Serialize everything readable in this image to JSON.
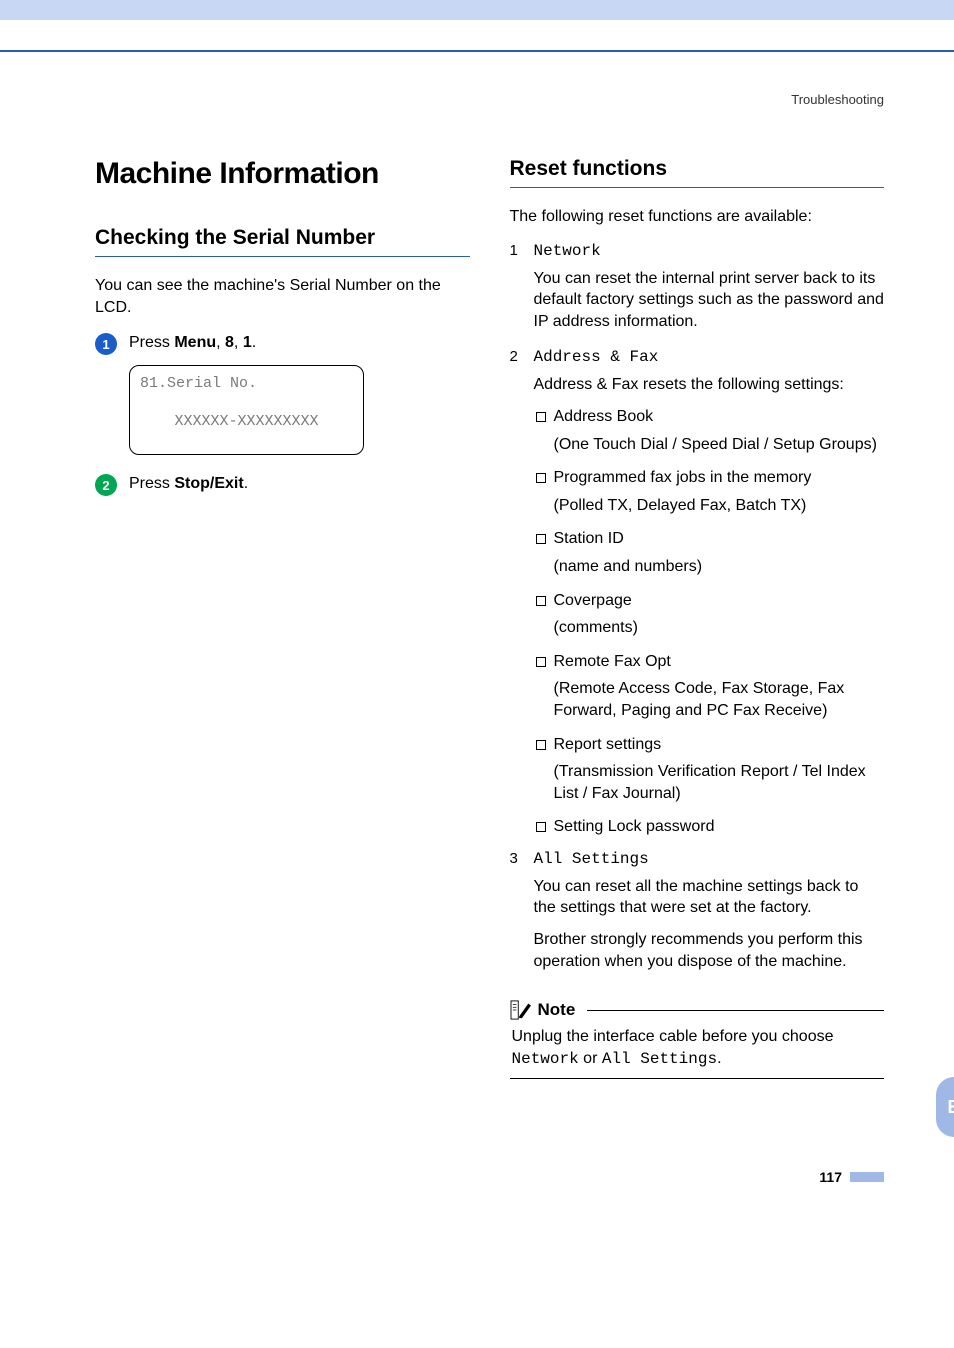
{
  "running_head": "Troubleshooting",
  "side_tab": "B",
  "page_number": "117",
  "left": {
    "h1": "Machine Information",
    "h2": "Checking the Serial Number",
    "intro": "You can see the machine's Serial Number on the LCD.",
    "step1_prefix": "Press ",
    "step1_b1": "Menu",
    "step1_mid1": ", ",
    "step1_b2": "8",
    "step1_mid2": ", ",
    "step1_b3": "1",
    "step1_suffix": ".",
    "lcd_line1": "81.Serial No.",
    "lcd_line2": "XXXXXX-XXXXXXXXX",
    "step2_prefix": "Press ",
    "step2_b1": "Stop/Exit",
    "step2_suffix": "."
  },
  "right": {
    "h2": "Reset functions",
    "intro": "The following reset functions are available:",
    "items": [
      {
        "n": "1",
        "label": "Network",
        "body": "You can reset the internal print server back to its default factory settings such as the password and IP address information."
      },
      {
        "n": "2",
        "label": "Address & Fax",
        "body": "Address & Fax resets the following settings:",
        "bullets": [
          {
            "title": "Address Book",
            "detail": "(One Touch Dial / Speed Dial / Setup Groups)"
          },
          {
            "title": "Programmed fax jobs in the memory",
            "detail": "(Polled TX, Delayed Fax, Batch TX)"
          },
          {
            "title": "Station ID",
            "detail": "(name and numbers)"
          },
          {
            "title": "Coverpage",
            "detail": "(comments)"
          },
          {
            "title": "Remote Fax Opt",
            "detail": "(Remote Access Code, Fax Storage, Fax Forward, Paging and PC Fax Receive)"
          },
          {
            "title": "Report settings",
            "detail": "(Transmission Verification Report / Tel Index List / Fax Journal)"
          },
          {
            "title": "Setting Lock password",
            "detail": ""
          }
        ]
      },
      {
        "n": "3",
        "label": "All Settings",
        "body": "You can reset all the machine settings back to the settings that were set at the factory.",
        "body2": "Brother strongly recommends you perform this operation when you dispose of the machine."
      }
    ],
    "note_label": "Note",
    "note_pre": "Unplug the interface cable before you choose ",
    "note_mono1": "Network",
    "note_mid": " or ",
    "note_mono2": "All Settings",
    "note_suffix": "."
  }
}
